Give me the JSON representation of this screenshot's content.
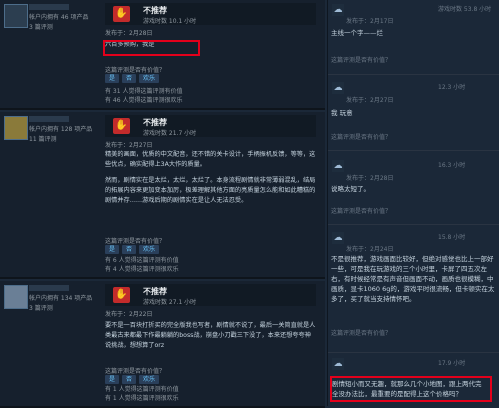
{
  "reviews": [
    {
      "stats": "帐户内拥有 46 项产品",
      "count": "3 篇评测",
      "verdict": "不推荐",
      "hours": "游戏时数 10.1 小时",
      "posted": "发布于：2月28日",
      "text": [
        "六百多预购，我是"
      ],
      "helpful_q": "这篇评测是否有价值？",
      "buttons": [
        "是",
        "否",
        "欢乐"
      ],
      "stats_lines": [
        "有 31 人觉得这篇评测有价值",
        "有 46 人觉得这篇评测很欢乐"
      ]
    },
    {
      "stats": "帐户内拥有 128 项产品",
      "count": "11 篇评测",
      "verdict": "不推荐",
      "hours": "游戏时数 21.7 小时",
      "posted": "发布于：2月27日",
      "text": [
        "精美的画面，优质的中文配音，还不错的关卡设计，手柄振机反馈，等等，这些优点，确实配得上3A大作的质量。",
        "然而，剧情实在是太烂，太烂，太烂了。本身流程剧情就非常薄弱混乱，结局的拓展内容来更加变本加厉，极差理解其他方面的亮质量怎么能和如此糟糕的剧情并存……游戏后期的剧情实在是让人无法忍受。"
      ],
      "helpful_q": "这篇评测是否有价值？",
      "buttons": [
        "是",
        "否",
        "欢乐"
      ],
      "stats_lines": [
        "有 6 人觉得这篇评测有价值",
        "有 4 人觉得这篇评测很欢乐"
      ]
    },
    {
      "stats": "帐户内拥有 134 项产品",
      "count": "3 篇评测",
      "verdict": "不推荐",
      "hours": "游戏时数 27.1 小时",
      "posted": "发布于：2月22日",
      "text": [
        "要不是一百块打折买的完全版我也写者，剧情就不说了，最后一关简直就是人类最古来都最下作最躺躺的boss战，崩盘小刀戳三下没了，本来还想夸夸神说挑战，想想算了orz"
      ],
      "helpful_q": "这篇评测是否有价值？",
      "buttons": [
        "是",
        "否",
        "欢乐"
      ],
      "stats_lines": [
        "有 1 人觉得这篇评测有价值",
        "有 1 人觉得这篇评测很欢乐"
      ]
    }
  ],
  "comments": [
    {
      "posted": "发布于：2月17日",
      "hours": "游戏时数 53.8 小时",
      "text": "主线一个字——烂",
      "helpful": "这篇评测是否有价值？"
    },
    {
      "posted": "发布于：2月27日",
      "hours": "12.3 小时",
      "text": "我     玩意",
      "helpful": "这篇评测是否有价值？"
    },
    {
      "posted": "发布于：2月28日",
      "hours": "16.3 小时",
      "text": "说略太短了。",
      "helpful": "这篇评测是否有价值？"
    },
    {
      "posted": "发布于：2月24日",
      "hours": "15.8 小时",
      "text": "不是很推荐，游戏画面比较好，但绝对感觉也比上一部好一些，可是我在玩游戏的三个小时里，卡屏了四五次左右，有时候经常是有声音但画面不动，画质也很模糊，中画质，显卡1060 6g的，游戏平时很流畅，但卡顿实在太多了，买了就当支持情怀吧。",
      "helpful": "这篇评测是否有价值？"
    },
    {
      "posted": "",
      "hours": "17.9 小时",
      "text": "剧情短小而又无趣，就那么几个小地图，跟上两代完全没办法比，最重要的是配得上这个价格吗？",
      "helpful": ""
    }
  ]
}
